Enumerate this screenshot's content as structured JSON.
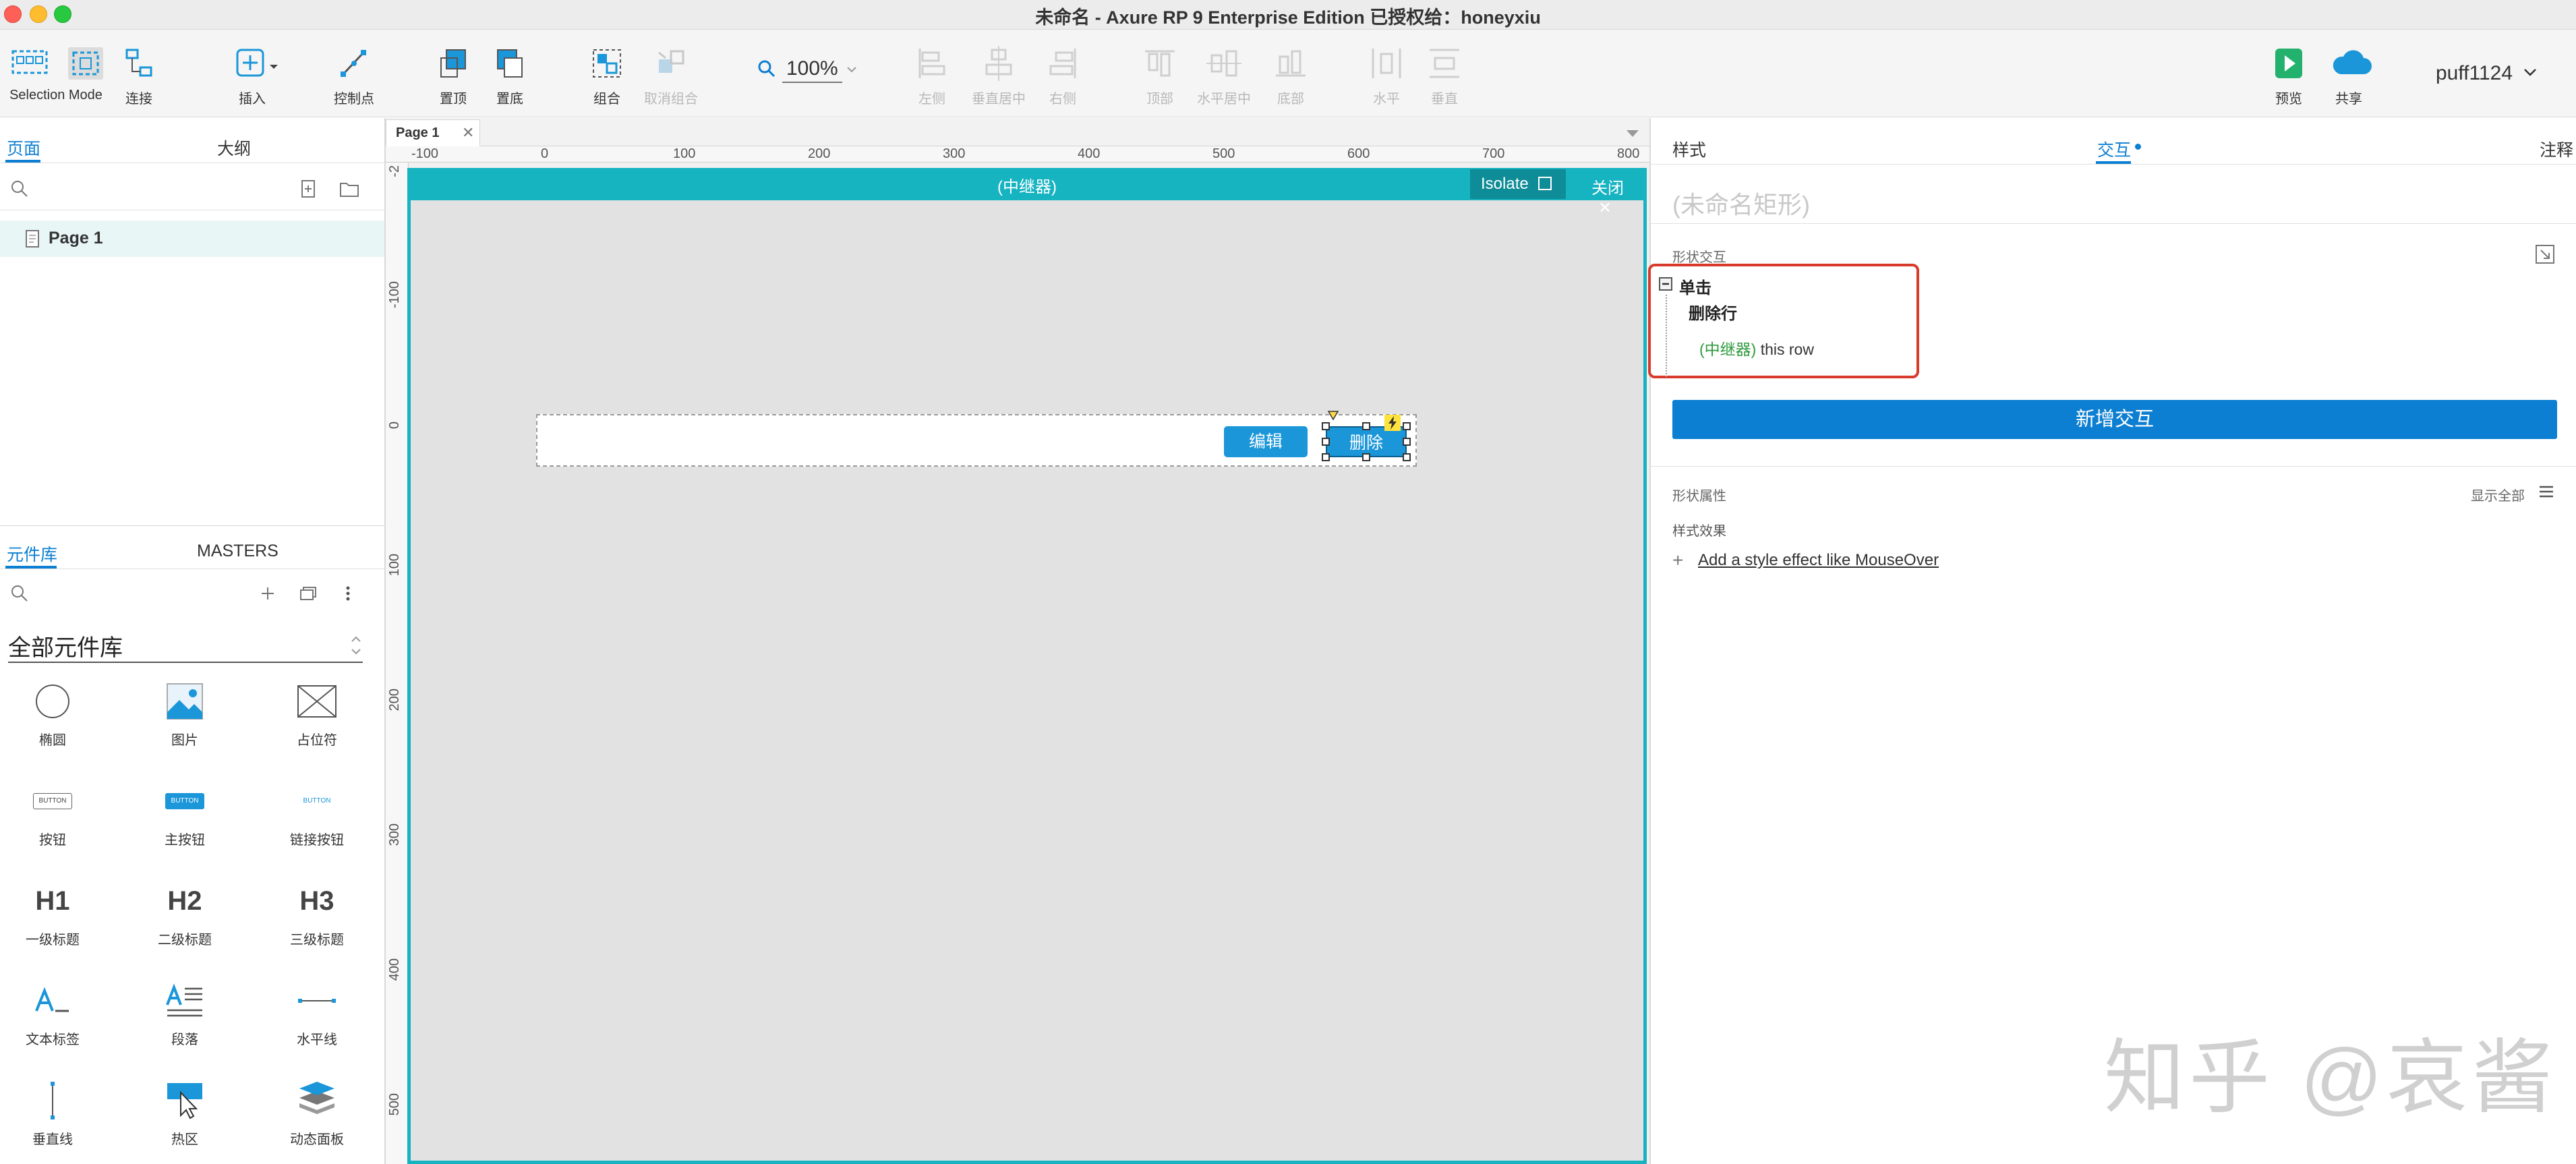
{
  "window": {
    "title": "未命名 - Axure RP 9 Enterprise Edition  已授权给：honeyxiu"
  },
  "toolbar": {
    "selection_mode_label": "Selection Mode",
    "connect_label": "连接",
    "insert_label": "插入",
    "control_point_label": "控制点",
    "bring_top_label": "置顶",
    "send_bottom_label": "置底",
    "group_label": "组合",
    "ungroup_label": "取消组合",
    "zoom_value": "100%",
    "align_left_label": "左侧",
    "align_center_v_label": "垂直居中",
    "align_right_label": "右侧",
    "align_top_label": "顶部",
    "align_center_h_label": "水平居中",
    "align_bottom_label": "底部",
    "distribute_h_label": "水平",
    "distribute_v_label": "垂直",
    "preview_label": "预览",
    "share_label": "共享",
    "username": "puff1124"
  },
  "left_panel": {
    "tabs": {
      "pages": "页面",
      "outline": "大纲"
    },
    "pages": [
      {
        "label": "Page 1"
      }
    ],
    "library_tabs": {
      "library": "元件库",
      "masters": "MASTERS"
    },
    "library_selector": "全部元件库",
    "library_items": [
      {
        "label": "椭圆",
        "icon": "circle-icon"
      },
      {
        "label": "图片",
        "icon": "image-icon"
      },
      {
        "label": "占位符",
        "icon": "placeholder-icon"
      },
      {
        "label": "按钮",
        "icon": "button-icon",
        "icon_text": "BUTTON"
      },
      {
        "label": "主按钮",
        "icon": "primary-button-icon",
        "icon_text": "BUTTON"
      },
      {
        "label": "链接按钮",
        "icon": "link-button-icon",
        "icon_text": "BUTTON"
      },
      {
        "label": "一级标题",
        "icon": "h1-icon",
        "icon_text": "H1"
      },
      {
        "label": "二级标题",
        "icon": "h2-icon",
        "icon_text": "H2"
      },
      {
        "label": "三级标题",
        "icon": "h3-icon",
        "icon_text": "H3"
      },
      {
        "label": "文本标签",
        "icon": "text-label-icon"
      },
      {
        "label": "段落",
        "icon": "paragraph-icon"
      },
      {
        "label": "水平线",
        "icon": "horizontal-line-icon"
      },
      {
        "label": "垂直线",
        "icon": "vertical-line-icon"
      },
      {
        "label": "热区",
        "icon": "hotspot-icon"
      },
      {
        "label": "动态面板",
        "icon": "dynamic-panel-icon"
      }
    ]
  },
  "canvas": {
    "page_tab": "Page 1",
    "h_ruler": [
      "-100",
      "0",
      "100",
      "200",
      "300",
      "400",
      "500",
      "600",
      "700",
      "800"
    ],
    "v_ruler": [
      "-2",
      "-100",
      "0",
      "100",
      "200",
      "300",
      "400",
      "500"
    ],
    "repeater_title": "(中继器)",
    "isolate_label": "Isolate",
    "close_label": "关闭",
    "edit_button": "编辑",
    "delete_button": "删除"
  },
  "right_panel": {
    "tabs": {
      "style": "样式",
      "interaction": "交互",
      "notes": "注释"
    },
    "shape_name_placeholder": "(未命名矩形)",
    "section_title": "形状交互",
    "event": "单击",
    "action": "删除行",
    "target_name": "(中继器)",
    "target_detail": " this row",
    "new_interaction_button": "新增交互",
    "shape_properties_label": "形状属性",
    "show_all_label": "显示全部",
    "style_effects_label": "样式效果",
    "add_style_effect_link": "Add a style effect like MouseOver"
  },
  "watermark": "知乎 @哀酱",
  "colors": {
    "accent": "#0d7fd2",
    "repeater": "#16b3c1",
    "button": "#1a96d9",
    "highlight": "#d83a2b",
    "target_green": "#2e9a3c"
  }
}
